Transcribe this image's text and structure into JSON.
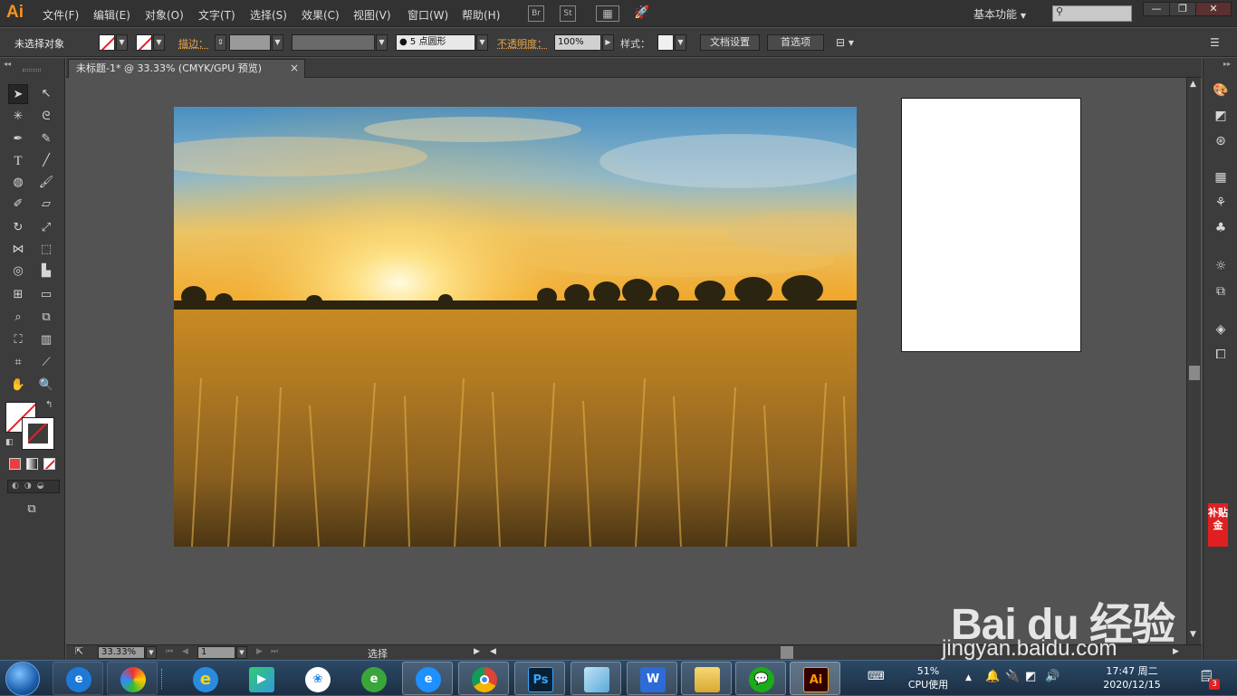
{
  "app": {
    "logo": "Ai",
    "menu": [
      "文件(F)",
      "编辑(E)",
      "对象(O)",
      "文字(T)",
      "选择(S)",
      "效果(C)",
      "视图(V)",
      "窗口(W)",
      "帮助(H)"
    ],
    "bridge_label": "Br",
    "stock_label": "St",
    "workspace": "基本功能",
    "window_controls": [
      "—",
      "❐",
      "✕"
    ]
  },
  "control_bar": {
    "selection_status": "未选择对象",
    "stroke_label": "描边：",
    "brush": "5 点圆形",
    "opacity_label": "不透明度：",
    "opacity_value": "100%",
    "style_label": "样式：",
    "doc_setup": "文档设置",
    "preferences": "首选项"
  },
  "document": {
    "tab_title": "未标题-1* @ 33.33% (CMYK/GPU 预览)",
    "close": "×"
  },
  "status_bar": {
    "zoom": "33.33%",
    "artboard_number": "1",
    "tool_status": "选择"
  },
  "side_badge": "补贴金",
  "taskbar": {
    "cpu_percent": "51%",
    "cpu_label": "CPU使用",
    "time": "17:47 周二",
    "date": "2020/12/15",
    "notification_count": "3",
    "apps": [
      "ie",
      "picasa",
      "ie-browser",
      "media-player",
      "baidu-netdisk",
      "360-browser",
      "ie-edge",
      "chrome",
      "photoshop",
      "app-blue",
      "wps",
      "explorer",
      "wechat",
      "illustrator"
    ],
    "ps_label": "Ps",
    "ai_label": "Ai",
    "wps_label": "W"
  },
  "watermark": {
    "logo": "Bai du 经验",
    "url": "jingyan.baidu.com"
  }
}
